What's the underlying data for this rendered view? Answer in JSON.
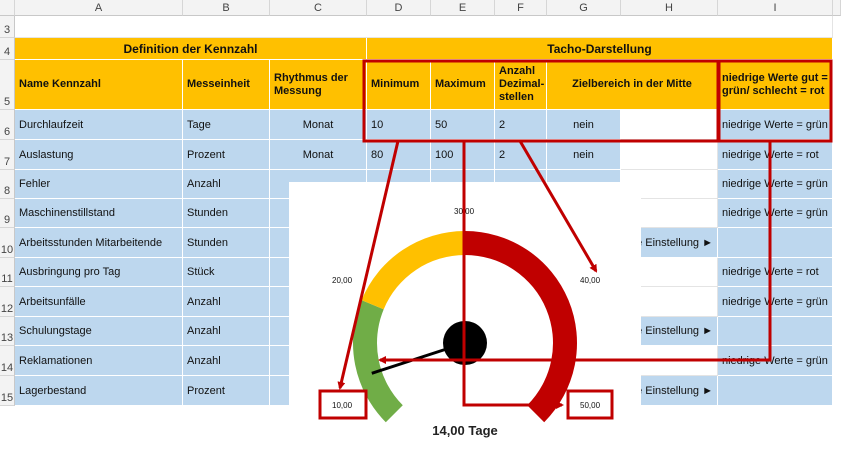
{
  "columns": [
    "A",
    "B",
    "C",
    "D",
    "E",
    "F",
    "G",
    "H",
    "I"
  ],
  "rows": [
    "3",
    "4",
    "5",
    "6",
    "7",
    "8",
    "9",
    "10",
    "11",
    "12",
    "13",
    "14",
    "15"
  ],
  "header": {
    "definition": "Definition der Kennzahl",
    "tacho": "Tacho-Darstellung",
    "name": "Name Kennzahl",
    "unit": "Messeinheit",
    "rhythm": "Rhythmus der Messung",
    "min": "Minimum",
    "max": "Maximum",
    "decimals": "Anzahl Dezimal-stellen",
    "target": "Zielbereich in der Mitte",
    "low": "niedrige Werte gut = grün/ schlecht = rot"
  },
  "data_rows": [
    {
      "name": "Durchlaufzeit",
      "unit": "Tage",
      "rhythm": "Monat",
      "min": "10",
      "max": "50",
      "dec": "2",
      "target": "nein",
      "h": "",
      "low": "niedrige Werte = grün"
    },
    {
      "name": "Auslastung",
      "unit": "Prozent",
      "rhythm": "Monat",
      "min": "80",
      "max": "100",
      "dec": "2",
      "target": "nein",
      "h": "",
      "low": "niedrige Werte = rot"
    },
    {
      "name": "Fehler",
      "unit": "Anzahl",
      "rhythm": "",
      "min": "",
      "max": "",
      "dec": "",
      "target": "",
      "h": "",
      "low": "niedrige Werte = grün"
    },
    {
      "name": "Maschinenstillstand",
      "unit": "Stunden",
      "rhythm": "",
      "min": "",
      "max": "",
      "dec": "",
      "target": "",
      "h": "",
      "low": "niedrige Werte = grün"
    },
    {
      "name": "Arbeitsstunden Mitarbeitende",
      "unit": "Stunden",
      "rhythm": "",
      "min": "",
      "max": "",
      "dec": "",
      "target": "",
      "h": "e Einstellung ►",
      "low": ""
    },
    {
      "name": "Ausbringung pro Tag",
      "unit": "Stück",
      "rhythm": "",
      "min": "",
      "max": "",
      "dec": "",
      "target": "",
      "h": "",
      "low": "niedrige Werte = rot"
    },
    {
      "name": "Arbeitsunfälle",
      "unit": "Anzahl",
      "rhythm": "",
      "min": "",
      "max": "",
      "dec": "",
      "target": "",
      "h": "",
      "low": "niedrige Werte = grün"
    },
    {
      "name": "Schulungstage",
      "unit": "Anzahl",
      "rhythm": "",
      "min": "",
      "max": "",
      "dec": "",
      "target": "",
      "h": "e Einstellung ►",
      "low": ""
    },
    {
      "name": "Reklamationen",
      "unit": "Anzahl",
      "rhythm": "",
      "min": "",
      "max": "",
      "dec": "",
      "target": "",
      "h": "",
      "low": "niedrige Werte = grün"
    },
    {
      "name": "Lagerbestand",
      "unit": "Prozent",
      "rhythm": "",
      "min": "",
      "max": "",
      "dec": "",
      "target": "",
      "h": "e Einstellung ►",
      "low": ""
    }
  ],
  "gauge": {
    "labels": [
      "10,00",
      "20,00",
      "30,00",
      "40,00",
      "50,00"
    ],
    "caption": "14,00 Tage",
    "min": 10,
    "max": 50,
    "value": 14,
    "colors": {
      "green": "#70ad47",
      "yellow": "#ffc000",
      "red": "#c00000",
      "annotation": "#c00000"
    }
  }
}
